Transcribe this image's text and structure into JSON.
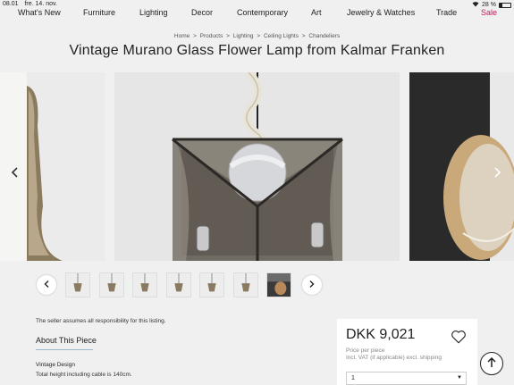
{
  "status_bar": {
    "time": "08.01",
    "date": "fre. 14. nov.",
    "battery": "28 %",
    "battery_level": 0.28
  },
  "nav": {
    "items": [
      "What's New",
      "Furniture",
      "Lighting",
      "Decor",
      "Contemporary",
      "Art",
      "Jewelry & Watches",
      "Trade",
      "Sale"
    ],
    "accent_color": "#c2185b"
  },
  "breadcrumb": [
    "Home",
    "Products",
    "Lighting",
    "Ceiling Lights",
    "Chandeliers"
  ],
  "breadcrumb_separator": ">",
  "title": "Vintage Murano Glass Flower Lamp from Kalmar Franken",
  "carousel": {
    "prev_icon": "chevron-left-icon",
    "next_icon": "chevron-right-icon",
    "thumbnail_count": 7,
    "selected_thumbnail": 6
  },
  "thumb_prev_icon": "chevron-left-icon",
  "thumb_next_icon": "chevron-right-icon",
  "seller_note": "The seller assumes all responsibility for this listing.",
  "about": {
    "heading": "About This Piece",
    "design_label": "Vintage Design",
    "text": "Total height including cable is 140cm."
  },
  "purchase": {
    "price": "DKK 9,021",
    "price_per": "Price per piece",
    "vat": "Incl. VAT (if applicable) excl. shipping",
    "quantity": "1"
  }
}
